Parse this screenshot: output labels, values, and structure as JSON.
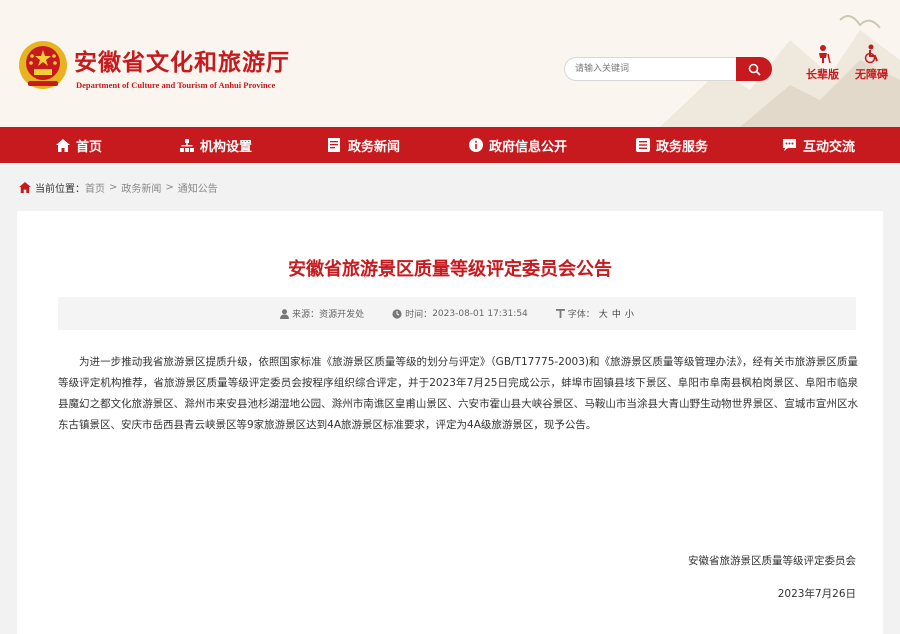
{
  "header": {
    "title": "安徽省文化和旅游厅",
    "subtitle": "Department of Culture and Tourism of Anhui Province",
    "search_placeholder": "请输入关键词",
    "accessibility": [
      {
        "label": "长辈版",
        "icon": "elder-icon"
      },
      {
        "label": "无障碍",
        "icon": "wheelchair-icon"
      }
    ]
  },
  "nav": {
    "items": [
      {
        "label": "首页",
        "icon": "home-icon"
      },
      {
        "label": "机构设置",
        "icon": "org-chart-icon"
      },
      {
        "label": "政务新闻",
        "icon": "news-icon"
      },
      {
        "label": "政府信息公开",
        "icon": "info-icon"
      },
      {
        "label": "政务服务",
        "icon": "service-icon"
      },
      {
        "label": "互动交流",
        "icon": "chat-icon"
      }
    ]
  },
  "breadcrumb": {
    "label": "当前位置：",
    "items": [
      "首页",
      "政务新闻",
      "通知公告"
    ],
    "separator": ">"
  },
  "article": {
    "title": "安徽省旅游景区质量等级评定委员会公告",
    "meta": {
      "source_label": "来源：",
      "source": "资源开发处",
      "time_label": "时间：",
      "time": "2023-08-01 17:31:54",
      "font_label": "字体：",
      "font_sizes": [
        "大",
        "中",
        "小"
      ]
    },
    "body": "为进一步推动我省旅游景区提质升级，依照国家标准《旅游景区质量等级的划分与评定》（GB/T17775-2003)和《旅游景区质量等级管理办法》，经有关市旅游景区质量等级评定机构推荐，省旅游景区质量等级评定委员会按程序组织综合评定，并于2023年7月25日完成公示，蚌埠市固镇县垓下景区、阜阳市阜南县枫柏岗景区、阜阳市临泉县魔幻之都文化旅游景区、滁州市来安县池杉湖湿地公园、滁州市南谯区皇甫山景区、六安市霍山县大峡谷景区、马鞍山市当涂县大青山野生动物世界景区、宣城市宣州区水东古镇景区、安庆市岳西县青云峡景区等9家旅游景区达到4A旅游景区标准要求，评定为4A级旅游景区，现予公告。",
    "signature": "安徽省旅游景区质量等级评定委员会",
    "date": "2023年7月26日"
  },
  "colors": {
    "brand_red": "#c71a1e",
    "header_bg": "#faf6ef",
    "page_bg": "#f2f2f2",
    "meta_bg": "#f4f4f4"
  }
}
